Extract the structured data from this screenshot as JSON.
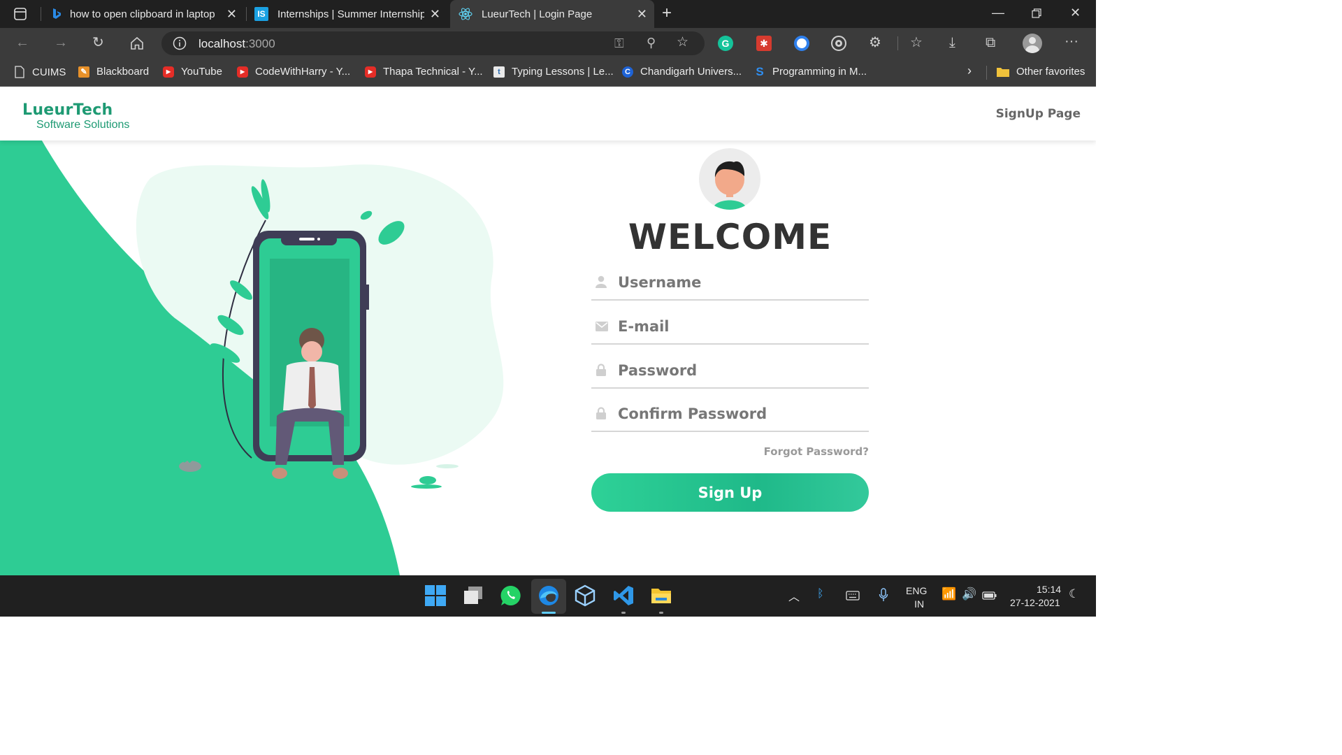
{
  "browser": {
    "tabs": [
      {
        "title": "how to open clipboard in laptop",
        "icon": "bing-icon",
        "active": false
      },
      {
        "title": "Internships | Summer Internship",
        "icon": "internshala-icon",
        "active": false
      },
      {
        "title": "LueurTech | Login Page",
        "icon": "react-icon",
        "active": true
      }
    ],
    "url_host": "localhost",
    "url_port": ":3000",
    "bookmarks": [
      {
        "label": "CUIMS",
        "icon": "page-icon"
      },
      {
        "label": "Blackboard",
        "icon": "blackboard-icon"
      },
      {
        "label": "YouTube",
        "icon": "youtube-icon"
      },
      {
        "label": "CodeWithHarry - Y...",
        "icon": "youtube-icon"
      },
      {
        "label": "Thapa Technical - Y...",
        "icon": "youtube-icon"
      },
      {
        "label": "Typing Lessons | Le...",
        "icon": "typing-icon"
      },
      {
        "label": "Chandigarh Univers...",
        "icon": "cu-icon"
      },
      {
        "label": "Programming in M...",
        "icon": "s-icon"
      }
    ],
    "other_favorites": "Other favorites"
  },
  "navbar": {
    "brand": "LueurTech",
    "tagline": "Software Solutions",
    "link": "SignUp Page"
  },
  "form": {
    "heading": "WELCOME",
    "fields": [
      {
        "placeholder": "Username",
        "icon": "user-icon"
      },
      {
        "placeholder": "E-mail",
        "icon": "mail-icon"
      },
      {
        "placeholder": "Password",
        "icon": "lock-icon"
      },
      {
        "placeholder": "Confirm Password",
        "icon": "lock-icon"
      }
    ],
    "forgot": "Forgot Password?",
    "submit": "Sign Up"
  },
  "taskbar": {
    "lang_line1": "ENG",
    "lang_line2": "IN",
    "time": "15:14",
    "date": "27-12-2021"
  },
  "colors": {
    "accent": "#2ecc94",
    "brand": "#1e9a73",
    "chrome_dark": "#202020",
    "chrome_mid": "#3b3b3b"
  }
}
